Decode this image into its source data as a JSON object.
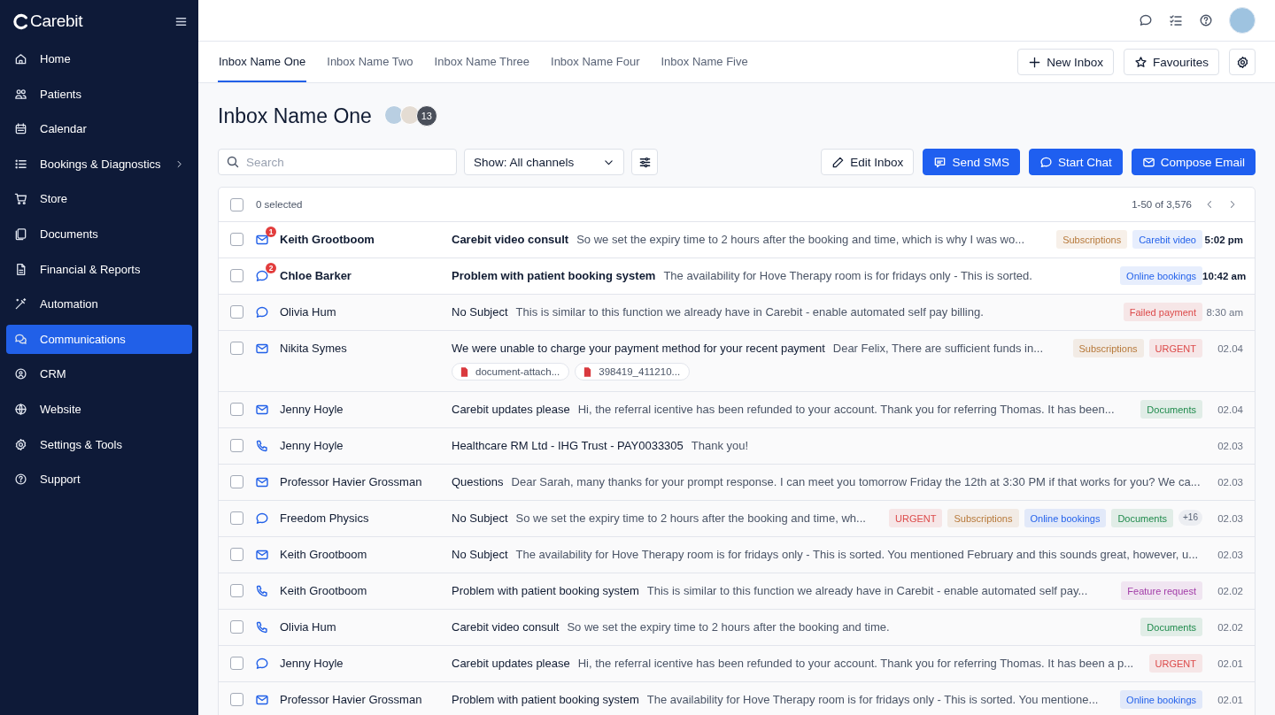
{
  "brand": "Carebit",
  "sidebar": {
    "items": [
      {
        "label": "Home",
        "selected": false,
        "expandable": false
      },
      {
        "label": "Patients",
        "selected": false,
        "expandable": false
      },
      {
        "label": "Calendar",
        "selected": false,
        "expandable": false
      },
      {
        "label": "Bookings & Diagnostics",
        "selected": false,
        "expandable": true
      },
      {
        "label": "Store",
        "selected": false,
        "expandable": false
      },
      {
        "label": "Documents",
        "selected": false,
        "expandable": false
      },
      {
        "label": "Financial & Reports",
        "selected": false,
        "expandable": false
      },
      {
        "label": "Automation",
        "selected": false,
        "expandable": false
      },
      {
        "label": "Communications",
        "selected": true,
        "expandable": false
      },
      {
        "label": "CRM",
        "selected": false,
        "expandable": false
      },
      {
        "label": "Website",
        "selected": false,
        "expandable": false
      },
      {
        "label": "Settings & Tools",
        "selected": false,
        "expandable": false
      },
      {
        "label": "Support",
        "selected": false,
        "expandable": false
      }
    ]
  },
  "tabs": [
    {
      "label": "Inbox Name One",
      "selected": true
    },
    {
      "label": "Inbox Name Two",
      "selected": false
    },
    {
      "label": "Inbox Name Three",
      "selected": false
    },
    {
      "label": "Inbox Name Four",
      "selected": false
    },
    {
      "label": "Inbox Name Five",
      "selected": false
    }
  ],
  "tab_actions": [
    "New Inbox",
    "Favourites"
  ],
  "title": "Inbox Name One",
  "member_count": "13",
  "search": {
    "placeholder": "Search"
  },
  "channel_filter": "Show: All channels",
  "actions": [
    {
      "label": "Edit Inbox",
      "kind": "edit"
    },
    {
      "label": "Send SMS",
      "kind": "sms"
    },
    {
      "label": "Start Chat",
      "kind": "chat"
    },
    {
      "label": "Compose Email",
      "kind": "email"
    }
  ],
  "table": {
    "all_selected": false,
    "selected_count": "0 selected",
    "pagination": "1-50 of 3,576",
    "rows": [
      {
        "kind": "email",
        "badge": "1",
        "unread": true,
        "checked": false,
        "name": "Keith Grootboom",
        "subject": "Carebit video consult",
        "preview": "So we set the expiry time to 2 hours after the booking and time, which is why I was wo...",
        "tags": [
          {
            "label": "Subscriptions",
            "color": "#b7793a"
          },
          {
            "label": "Carebit video",
            "color": "#2563eb"
          }
        ],
        "time": "5:02 pm"
      },
      {
        "kind": "chat",
        "badge": "2",
        "unread": true,
        "checked": false,
        "name": "Chloe Barker",
        "subject": "Problem with patient booking system",
        "preview": "The availability for Hove Therapy room is for fridays only - This is sorted.",
        "tags": [
          {
            "label": "Online bookings",
            "color": "#2563eb"
          }
        ],
        "time": "10:42 am"
      },
      {
        "kind": "chat",
        "unread": false,
        "checked": false,
        "name": "Olivia Hum",
        "subject": "No Subject",
        "preview": "This is similar to this function we already have in Carebit - enable automated self pay billing.",
        "tags": [
          {
            "label": "Failed payment",
            "color": "#dc4a4a"
          }
        ],
        "time": "8:30 am"
      },
      {
        "kind": "email",
        "unread": false,
        "checked": false,
        "name": "Nikita Symes",
        "subject": "We were unable to charge your payment method for your recent payment",
        "preview": "Dear Felix, There are sufficient funds in...",
        "tags": [
          {
            "label": "Subscriptions",
            "color": "#b7793a"
          },
          {
            "label": "URGENT",
            "color": "#dc4a4a"
          }
        ],
        "time": "02.04",
        "attachments": [
          "document-attach...",
          "398419_411210..."
        ]
      },
      {
        "kind": "email",
        "unread": false,
        "checked": false,
        "name": "Jenny Hoyle",
        "subject": "Carebit updates please",
        "preview": "Hi, the referral icentive has been refunded to your account. Thank you for referring Thomas. It has been...",
        "tags": [
          {
            "label": "Documents",
            "color": "#1f8a4c"
          }
        ],
        "time": "02.04"
      },
      {
        "kind": "phone",
        "unread": false,
        "checked": false,
        "name": "Jenny Hoyle",
        "subject": "Healthcare RM Ltd - IHG Trust - PAY0033305",
        "preview": "Thank you!",
        "tags": [],
        "time": "02.03"
      },
      {
        "kind": "email",
        "unread": false,
        "checked": false,
        "name": "Professor Havier Grossman",
        "subject": "Questions",
        "preview": "Dear Sarah, many thanks for your prompt response. I can meet you tomorrow Friday the 12th at 3:30 PM if that works for you? We ca...",
        "tags": [],
        "time": "02.03"
      },
      {
        "kind": "chat",
        "unread": false,
        "checked": false,
        "name": "Freedom Physics",
        "subject": "No Subject",
        "preview": "So we set the expiry time to 2 hours after the booking and time, wh...",
        "tags": [
          {
            "label": "URGENT",
            "color": "#dc4a4a"
          },
          {
            "label": "Subscriptions",
            "color": "#b7793a"
          },
          {
            "label": "Online bookings",
            "color": "#2563eb"
          },
          {
            "label": "Documents",
            "color": "#1f8a4c"
          }
        ],
        "more": "+16",
        "time": "02.03"
      },
      {
        "kind": "email",
        "unread": false,
        "checked": false,
        "name": "Keith Grootboom",
        "subject": "No Subject",
        "preview": "The availability for Hove Therapy room is for fridays only - This is sorted. You mentioned February and this sounds great, however, u...",
        "tags": [],
        "time": "02.03"
      },
      {
        "kind": "phone",
        "unread": false,
        "checked": false,
        "name": "Keith Grootboom",
        "subject": "Problem with patient booking system",
        "preview": "This is similar to this function we already have in Carebit - enable automated self pay...",
        "tags": [
          {
            "label": "Feature request",
            "color": "#a23ca8"
          }
        ],
        "time": "02.02"
      },
      {
        "kind": "phone",
        "unread": false,
        "checked": false,
        "name": "Olivia Hum",
        "subject": "Carebit video consult",
        "preview": "So we set the expiry time to 2 hours after the booking and time.",
        "tags": [
          {
            "label": "Documents",
            "color": "#1f8a4c"
          }
        ],
        "time": "02.02"
      },
      {
        "kind": "chat",
        "unread": false,
        "checked": false,
        "name": "Jenny Hoyle",
        "subject": "Carebit updates please",
        "preview": "Hi, the referral icentive has been refunded to your account. Thank you for referring Thomas. It has been a p...",
        "tags": [
          {
            "label": "URGENT",
            "color": "#dc4a4a"
          }
        ],
        "time": "02.01"
      },
      {
        "kind": "email",
        "unread": false,
        "checked": false,
        "name": "Professor Havier Grossman",
        "subject": "Problem with patient booking system",
        "preview": "The availability for Hove Therapy room is for fridays only - This is sorted. You mentione...",
        "tags": [
          {
            "label": "Online bookings",
            "color": "#2563eb"
          }
        ],
        "time": "02.01"
      }
    ]
  }
}
